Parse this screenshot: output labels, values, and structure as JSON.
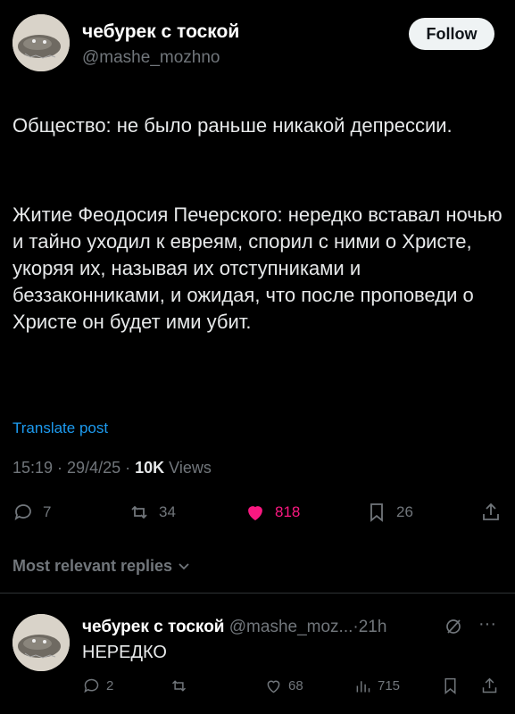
{
  "post": {
    "author_name": "чебурек с тоской",
    "author_handle": "@mashe_mozhno",
    "follow_label": "Follow",
    "paragraph1": "Общество: не было раньше никакой депрессии.",
    "paragraph2": "Житие Феодосия Печерского: нередко вставал ночью и тайно уходил к евреям, спорил с ними о Христе, укоряя их, называя их отступниками и беззаконниками, и ожидая, что после проповеди о Христе он будет ими убит.",
    "translate_label": "Translate post",
    "time": "15:19",
    "date": "29/4/25",
    "views_count": "10K",
    "views_label": "Views",
    "replies": "7",
    "reposts": "34",
    "likes": "818",
    "bookmarks": "26"
  },
  "sort_label": "Most relevant replies",
  "reply": {
    "author_name": "чебурек с тоской",
    "author_handle": "@mashe_moz...",
    "age": "21h",
    "text": "НЕРЕДКО",
    "replies": "2",
    "likes": "68",
    "views": "715"
  },
  "colors": {
    "accent": "#1d9bf0",
    "like": "#f91880",
    "muted": "#71767b",
    "background": "#000000"
  }
}
